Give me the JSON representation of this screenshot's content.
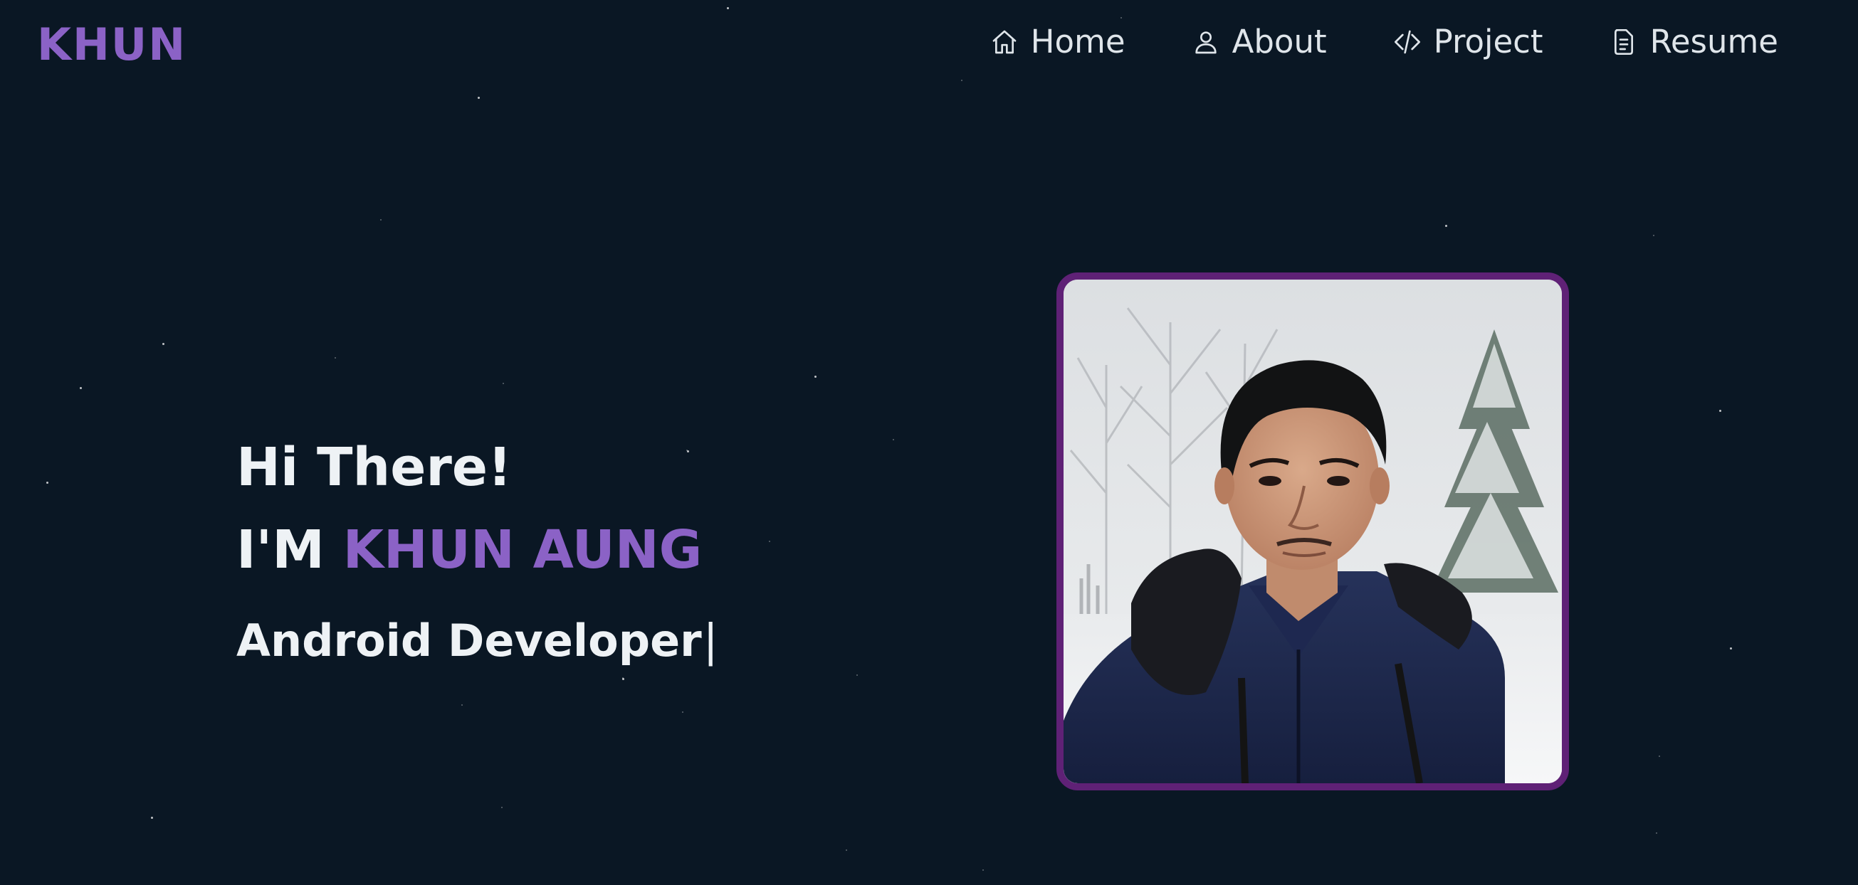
{
  "brand": {
    "logo_text": "KHUN",
    "color": "#8b62c6"
  },
  "nav": {
    "items": [
      {
        "label": "Home",
        "icon": "home-icon"
      },
      {
        "label": "About",
        "icon": "user-icon"
      },
      {
        "label": "Project",
        "icon": "code-icon"
      },
      {
        "label": "Resume",
        "icon": "document-icon"
      }
    ]
  },
  "hero": {
    "greeting": "Hi There!",
    "intro_prefix": "I'M",
    "name": "KHUN AUNG",
    "role": "Android Developer",
    "cursor": "|"
  },
  "portrait": {
    "alt": "Portrait of a man in a navy fur-hooded winter jacket in a snowy forest",
    "frame_color": "#5f2176"
  },
  "theme": {
    "background": "#0a1724",
    "accent": "#8b62c6",
    "text": "#eef2f5"
  }
}
